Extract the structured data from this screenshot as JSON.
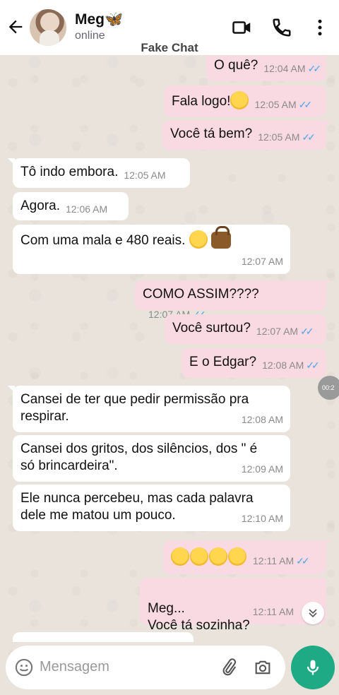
{
  "header": {
    "name": "Meg",
    "name_emoji": "🦋",
    "status": "online",
    "app_title": "Fake Chat"
  },
  "messages": [
    {
      "dir": "out",
      "text": "O quê?",
      "time": "12:04 AM",
      "read": true
    },
    {
      "dir": "out",
      "text": "Fala logo!",
      "emoji": "flushed",
      "time": "12:05 AM",
      "read": true
    },
    {
      "dir": "out",
      "text": "Você tá bem?",
      "time": "12:05 AM",
      "read": true
    },
    {
      "dir": "in",
      "text": "Tô indo embora.",
      "time": "12:05 AM"
    },
    {
      "dir": "in",
      "text": "Agora.",
      "time": "12:06 AM"
    },
    {
      "dir": "in",
      "text": "Com uma mala e 480 reais.",
      "emoji": "pensive, handbag",
      "time": "12:07 AM"
    },
    {
      "dir": "out",
      "text": "COMO ASSIM????",
      "time": "12:07 AM",
      "read": true
    },
    {
      "dir": "out",
      "text": "Você surtou?",
      "time": "12:07 AM",
      "read": true
    },
    {
      "dir": "out",
      "text": "E o Edgar?",
      "time": "12:08 AM",
      "read": true
    },
    {
      "dir": "in",
      "text": "Cansei de ter que pedir permissão pra respirar.",
      "time": "12:08 AM"
    },
    {
      "dir": "in",
      "text": "Cansei dos gritos, dos silêncios, dos \" é só brincardeira\".",
      "time": "12:09 AM"
    },
    {
      "dir": "in",
      "text": "Ele nunca percebeu, mas  cada palavra dele me matou um pouco.",
      "time": "12:10 AM"
    },
    {
      "dir": "out",
      "text": "",
      "emoji": "4x loudly-crying",
      "time": "12:11 AM",
      "read": true
    },
    {
      "dir": "out",
      "text": "Meg...\nVocê tá sozinha?",
      "time": "12:11 AM",
      "read": false
    }
  ],
  "overlay": {
    "timer_text": "00:2"
  },
  "input": {
    "placeholder": "Mensagem"
  },
  "colors": {
    "outgoing_bubble": "#f9d9e2",
    "incoming_bubble": "#ffffff",
    "read_ticks": "#4fa6e8",
    "mic_button": "#1faa86"
  },
  "icons": [
    "back-arrow-icon",
    "video-call-icon",
    "phone-icon",
    "more-vert-icon",
    "emoji-icon",
    "attach-icon",
    "camera-icon",
    "mic-icon",
    "chevron-double-down-icon"
  ]
}
